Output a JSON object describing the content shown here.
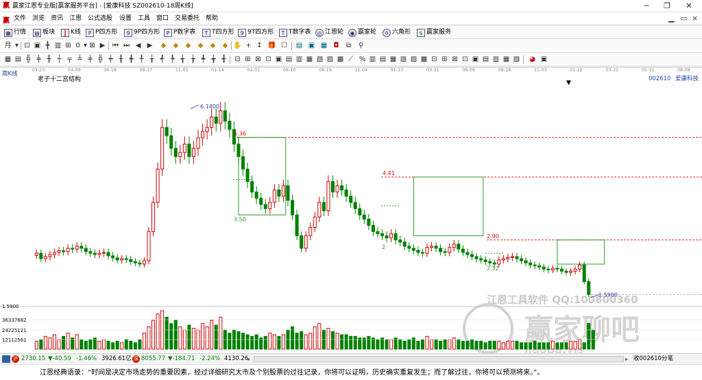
{
  "window": {
    "title": "赢家江恩专业版[赢家服务平台] - [爱康科技  SZ002610-18周K线]",
    "min_icon": "minimize-icon",
    "max_icon": "restore-icon",
    "close_icon": "close-icon"
  },
  "menu": [
    "文件",
    "浏览",
    "资讯",
    "江恩",
    "公式选股",
    "设置",
    "工具",
    "窗口",
    "交易委托",
    "帮助"
  ],
  "toolbar1": [
    {
      "label": "行情",
      "icon": "grid-icon"
    },
    {
      "label": "板块",
      "icon": "blocks-icon"
    },
    {
      "label": "K线",
      "icon": "kline-icon"
    },
    {
      "label": "P四方形",
      "icon": "square-p-icon"
    },
    {
      "label": "9P四方形",
      "icon": "square-9p-icon"
    },
    {
      "label": "P数字表",
      "icon": "table-p-icon"
    },
    {
      "label": "T四方形",
      "icon": "square-t-icon"
    },
    {
      "label": "9T四方形",
      "icon": "square-9t-icon"
    },
    {
      "label": "T数字表",
      "icon": "table-t-icon"
    },
    {
      "label": "江恩轮",
      "icon": "wheel-icon"
    },
    {
      "label": "赢家轮",
      "icon": "wheel2-icon"
    },
    {
      "label": "六角形",
      "icon": "hexagon-icon"
    },
    {
      "label": "赢家服务",
      "icon": "dollar-icon"
    }
  ],
  "chart_panel": {
    "period_label": "周K线",
    "structure_label": "老子十二宫结构",
    "stock_code": "002610",
    "stock_name": "爱康科技",
    "watermark_1": "江恩工具软件  QQ:100800360",
    "watermark_2": "赢家聊吧",
    "watermark_3": "jiaoba.yjs"
  },
  "chart_data": {
    "type": "candlestick",
    "date_axis_ticks": [
      "03-23",
      "04-09",
      "06-18",
      "08-27",
      "11-05",
      "01-14",
      "04-01",
      "06-10",
      "08-19",
      "11-04",
      "01-13",
      "03-31",
      "06-09",
      "08-18",
      "11-03",
      "01-12",
      "03-22",
      "05-31",
      "08-08"
    ],
    "price_annotations": [
      {
        "label": "6.1400",
        "price": 6.14,
        "kind": "high"
      },
      {
        "label": "5.36",
        "price": 5.36,
        "kind": "box-top"
      },
      {
        "label": "3.50",
        "price": 3.5,
        "kind": "box-bottom"
      },
      {
        "label": "4.41",
        "price": 4.41,
        "kind": "box-top"
      },
      {
        "label": "2",
        "price": 2.75,
        "kind": "box-bottom"
      },
      {
        "label": "2.90",
        "price": 2.9,
        "kind": "box-top"
      },
      {
        "label": "2.32",
        "price": 2.32,
        "kind": "box-bottom"
      },
      {
        "label": "1.5900",
        "price": 1.59,
        "kind": "low"
      }
    ],
    "volume_axis_labels": [
      "1.5900",
      "36337682",
      "24225121",
      "12112561"
    ],
    "volume_axis_values": [
      36337682,
      24225121,
      12112561
    ],
    "prices": [
      2.58,
      2.45,
      2.5,
      2.55,
      2.6,
      2.64,
      2.62,
      2.7,
      2.68,
      2.75,
      2.7,
      2.62,
      2.58,
      2.55,
      2.58,
      2.6,
      2.52,
      2.47,
      2.42,
      2.45,
      2.43,
      2.38,
      2.35,
      2.32,
      2.4,
      3.1,
      3.8,
      4.6,
      5.6,
      5.4,
      5.1,
      4.9,
      5.0,
      5.2,
      4.9,
      5.1,
      5.35,
      5.5,
      5.6,
      5.85,
      5.7,
      6.0,
      5.75,
      5.55,
      5.2,
      4.9,
      4.6,
      4.3,
      4.05,
      3.9,
      3.75,
      3.65,
      3.8,
      4.1,
      3.95,
      4.2,
      3.85,
      3.5,
      3.0,
      2.7,
      3.0,
      3.2,
      3.45,
      3.8,
      3.6,
      4.3,
      4.05,
      4.2,
      4.1,
      3.95,
      3.8,
      3.65,
      3.5,
      3.4,
      3.25,
      3.1,
      3.05,
      3.0,
      2.95,
      3.05,
      2.9,
      2.85,
      2.75,
      2.7,
      2.65,
      2.6,
      2.58,
      2.72,
      2.75,
      2.7,
      2.62,
      2.6,
      2.72,
      2.8,
      2.68,
      2.6,
      2.55,
      2.5,
      2.45,
      2.42,
      2.38,
      2.35,
      2.32,
      2.42,
      2.45,
      2.48,
      2.5,
      2.45,
      2.4,
      2.35,
      2.3,
      2.28,
      2.25,
      2.2,
      2.18,
      2.22,
      2.2,
      2.15,
      2.12,
      2.15,
      2.2,
      2.3,
      1.9,
      1.59
    ],
    "volumes": [
      5,
      6,
      8,
      7,
      9,
      6,
      8,
      10,
      7,
      9,
      6,
      5,
      6,
      7,
      5,
      6,
      5,
      4,
      5,
      4,
      6,
      5,
      4,
      6,
      10,
      14,
      18,
      22,
      24,
      20,
      16,
      18,
      14,
      12,
      15,
      13,
      12,
      16,
      14,
      18,
      15,
      20,
      12,
      10,
      12,
      11,
      10,
      9,
      8,
      9,
      7,
      8,
      10,
      9,
      8,
      9,
      12,
      14,
      10,
      11,
      9,
      10,
      14,
      16,
      12,
      13,
      11,
      10,
      9,
      9,
      8,
      8,
      7,
      7,
      8,
      7,
      6,
      7,
      6,
      6,
      7,
      6,
      5,
      6,
      7,
      5,
      6,
      8,
      6,
      6,
      5,
      6,
      6,
      7,
      6,
      5,
      5,
      6,
      5,
      5,
      4,
      5,
      5,
      5,
      4,
      5,
      5,
      5,
      4,
      4,
      4,
      5,
      4,
      4,
      4,
      5,
      4,
      4,
      4,
      5,
      5,
      6,
      4,
      16,
      12
    ],
    "price_range": [
      1.3,
      6.6
    ]
  },
  "status_bar": {
    "idx1": "2730.15",
    "idx1_chg": "▼-40.59",
    "idx1_pct": "-1.46%",
    "idx1_amt": "3926.61亿",
    "idx2": "8055.77",
    "idx2_chg": "▼-184.71",
    "idx2_pct": "-2.24%",
    "idx2_amt": "4130.26",
    "right_label": "收002610分笔"
  },
  "quote": {
    "text": "江恩经典语录：“时间是决定市场走势的重要因素，经过详细研究大市及个别股票的过往记录，你将可以证明，历史确实重复发生；而了解过往，你将可以预测将来。”。"
  },
  "colors": {
    "up": "#cc0000",
    "down": "#008000",
    "box_line": "#2a9d2a",
    "resistance": "#e60000",
    "support_label": "#2a8a2a",
    "high_label": "#3333aa",
    "index_down": "#008000"
  }
}
